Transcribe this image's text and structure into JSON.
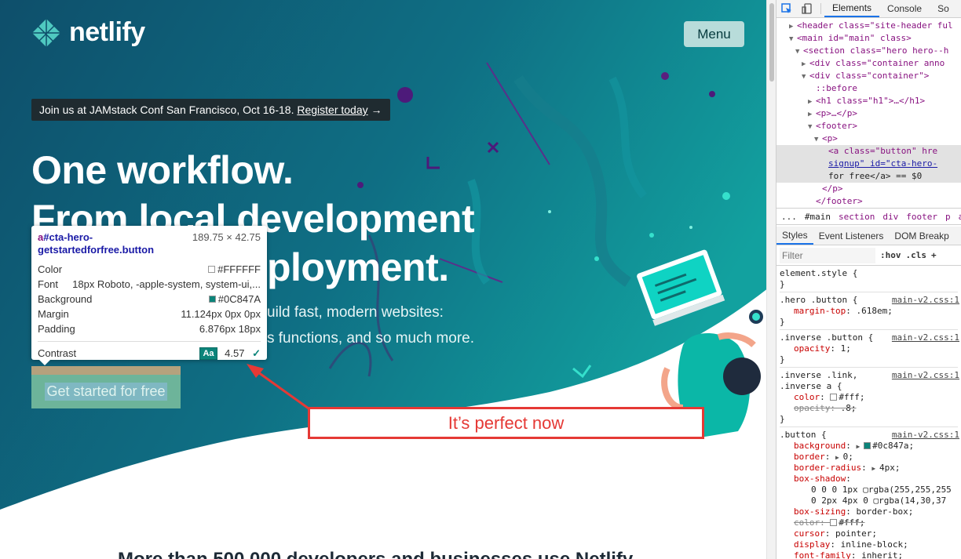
{
  "site": {
    "logo_text": "netlify",
    "menu_label": "Menu",
    "announcement_text": "Join us at JAMstack Conf San Francisco, Oct 16-18.",
    "announcement_link": "Register today",
    "announcement_arrow": "→",
    "headline_lines": [
      "One workflow.",
      "From local development",
      "ployment."
    ],
    "subtext_lines": [
      "uild fast, modern websites:",
      "s functions, and so much more."
    ],
    "cta_label": "Get started for free",
    "bottom_text": "More than 500,000 developers and businesses use Netlify",
    "colors": {
      "hero_dark": "#0e4f6b",
      "hero_teal": "#11929a",
      "cta": "#0c847a",
      "annotation": "#e53935"
    }
  },
  "tooltip": {
    "selector_tag": "a",
    "selector_rest": "#cta-hero-getstartedforfree.button",
    "size": "189.75 × 42.75",
    "rows": [
      {
        "label": "Color",
        "value": "#FFFFFF",
        "swatch": "#FFFFFF"
      },
      {
        "label": "Font",
        "value": "18px Roboto, -apple-system, system-ui,..."
      },
      {
        "label": "Background",
        "value": "#0C847A",
        "swatch": "#0C847A"
      },
      {
        "label": "Margin",
        "value": "11.124px 0px 0px"
      },
      {
        "label": "Padding",
        "value": "6.876px 18px"
      }
    ],
    "contrast_label": "Contrast",
    "contrast_badge": "Aa",
    "contrast_value": "4.57",
    "contrast_check": "✓"
  },
  "annotation": {
    "text": "It’s perfect now"
  },
  "devtools": {
    "tabs": [
      "Elements",
      "Console",
      "So"
    ],
    "active_tab": "Elements",
    "dom_lines": [
      {
        "indent": 2,
        "tri": "▶",
        "html": "<header class=\"site-header ful"
      },
      {
        "indent": 2,
        "tri": "▼",
        "html": "<main id=\"main\" class>"
      },
      {
        "indent": 3,
        "tri": "▼",
        "html": "<section class=\"hero hero--h"
      },
      {
        "indent": 4,
        "tri": "▶",
        "html": "<div class=\"container anno"
      },
      {
        "indent": 4,
        "tri": "▼",
        "html": "<div class=\"container\">"
      },
      {
        "indent": 5,
        "tri": "",
        "html": "::before"
      },
      {
        "indent": 5,
        "tri": "▶",
        "html": "<h1 class=\"h1\">…</h1>"
      },
      {
        "indent": 5,
        "tri": "▶",
        "html": "<p>…</p>"
      },
      {
        "indent": 5,
        "tri": "▼",
        "html": "<footer>"
      },
      {
        "indent": 6,
        "tri": "▼",
        "html": "<p>"
      },
      {
        "indent": 7,
        "tri": "",
        "html": "<a class=\"button\" hre"
      },
      {
        "indent": 7,
        "tri": "",
        "html": "signup\" id=\"cta-hero-"
      },
      {
        "indent": 7,
        "tri": "",
        "html": "for free</a> == $0"
      },
      {
        "indent": 6,
        "tri": "",
        "html": "</p>"
      },
      {
        "indent": 5,
        "tri": "",
        "html": "</footer>"
      }
    ],
    "dots": "...",
    "breadcrumbs": [
      "...",
      "#main",
      "section",
      "div",
      "footer",
      "p",
      "a"
    ],
    "styles_tabs": [
      "Styles",
      "Event Listeners",
      "DOM Breakp"
    ],
    "filter_placeholder": "Filter",
    "hov": ":hov",
    "cls": ".cls",
    "plus": "+",
    "rules": [
      {
        "selector": "element.style {",
        "source": "",
        "props": []
      },
      {
        "selector": ".hero .button {",
        "source": "main-v2.css:1",
        "props": [
          {
            "name": "margin-top",
            "value": ".618em;"
          }
        ]
      },
      {
        "selector": ".inverse .button {",
        "source": "main-v2.css:1",
        "props": [
          {
            "name": "opacity",
            "value": "1;"
          }
        ]
      },
      {
        "selector": ".inverse .link,",
        "selector2": ".inverse a {",
        "source": "main-v2.css:1",
        "props": [
          {
            "name": "color",
            "value": "#fff;",
            "swatch": "#ffffff"
          },
          {
            "name": "opacity",
            "value": ".8;",
            "strike": true
          }
        ]
      },
      {
        "selector": ".button {",
        "source": "main-v2.css:1",
        "props": [
          {
            "name": "background",
            "value": "#0c847a;",
            "swatch": "#0c847a",
            "tri": true
          },
          {
            "name": "border",
            "value": "0;",
            "tri": true
          },
          {
            "name": "border-radius",
            "value": "4px;",
            "tri": true
          },
          {
            "name": "box-shadow",
            "value": ""
          },
          {
            "name": "",
            "value": "0 0 0 1px ▢rgba(255,255,255",
            "sub": true
          },
          {
            "name": "",
            "value": "0 2px 4px 0 ▢rgba(14,30,37",
            "sub": true
          },
          {
            "name": "box-sizing",
            "value": "border-box;"
          },
          {
            "name": "color",
            "value": "#fff;",
            "swatch": "#ffffff",
            "strike": true
          },
          {
            "name": "cursor",
            "value": "pointer;"
          },
          {
            "name": "display",
            "value": "inline-block;"
          },
          {
            "name": "font-family",
            "value": "inherit;"
          }
        ]
      }
    ]
  }
}
